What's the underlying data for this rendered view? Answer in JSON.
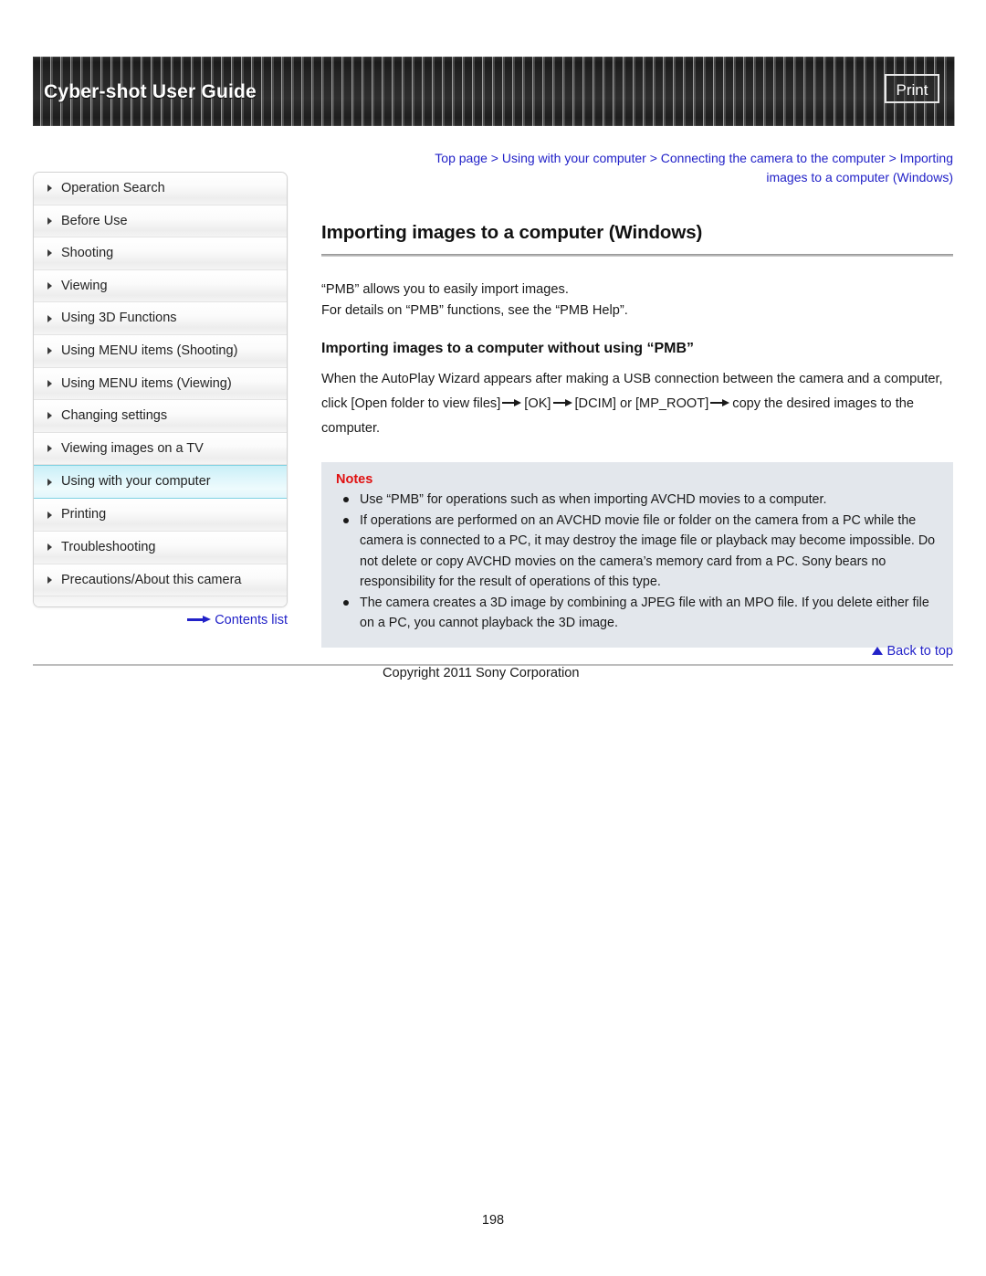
{
  "header": {
    "title": "Cyber-shot User Guide",
    "print_label": "Print"
  },
  "sidebar": {
    "items": [
      {
        "label": "Operation Search"
      },
      {
        "label": "Before Use"
      },
      {
        "label": "Shooting"
      },
      {
        "label": "Viewing"
      },
      {
        "label": "Using 3D Functions"
      },
      {
        "label": "Using MENU items (Shooting)"
      },
      {
        "label": "Using MENU items (Viewing)"
      },
      {
        "label": "Changing settings"
      },
      {
        "label": "Viewing images on a TV"
      },
      {
        "label": "Using with your computer"
      },
      {
        "label": "Printing"
      },
      {
        "label": "Troubleshooting"
      },
      {
        "label": "Precautions/About this camera"
      }
    ],
    "active_index": 9,
    "contents_list_label": "Contents list"
  },
  "breadcrumb": {
    "line1": "Top page > Using with your computer > Connecting the camera to the computer > Importing",
    "line2": "images to a computer (Windows)"
  },
  "main": {
    "title": "Importing images to a computer (Windows)",
    "intro_line1": "“PMB” allows you to easily import images.",
    "intro_line2": "For details on “PMB” functions, see the “PMB Help”.",
    "subheading": "Importing images to a computer without using “PMB”",
    "para_part1": "When the AutoPlay Wizard appears after making a USB connection between the camera and a computer, click [Open folder to view files]",
    "para_part2": "[OK]",
    "para_part3": "[DCIM] or [MP_ROOT]",
    "para_part4": "copy the desired images to the computer."
  },
  "notes": {
    "title": "Notes",
    "items": [
      "Use “PMB” for operations such as when importing AVCHD movies to a computer.",
      "If operations are performed on an AVCHD movie file or folder on the camera from a PC while the camera is connected to a PC, it may destroy the image file or playback may become impossible. Do not delete or copy AVCHD movies on the camera’s memory card from a PC. Sony bears no responsibility for the result of operations of this type.",
      "The camera creates a 3D image by combining a JPEG file with an MPO file. If you delete either file on a PC, you cannot playback the 3D image."
    ]
  },
  "footer": {
    "back_to_top_label": "Back to top",
    "copyright": "Copyright 2011 Sony Corporation",
    "page_number": "198"
  },
  "colors": {
    "link": "#2222c8",
    "notes_red": "#e01010",
    "notes_bg": "#e3e7ec",
    "active_nav": "#c9eff7"
  }
}
